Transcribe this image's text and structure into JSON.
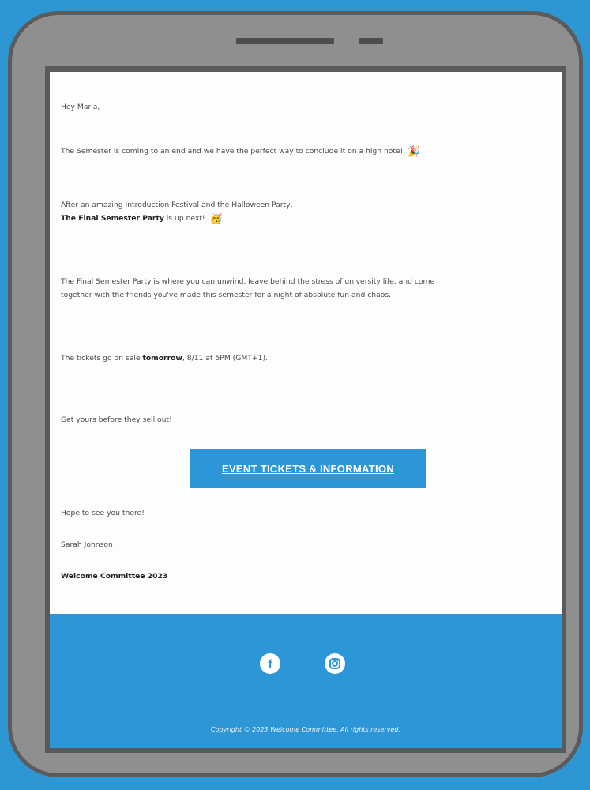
{
  "email": {
    "greeting": "Hey Maria,",
    "intro": "The Semester is coming to an end and we have the perfect way to conclude it on a high note!",
    "line2": "After an amazing Introduction Festival and the Halloween Party,",
    "highlight_bold": "The Final Semester Party",
    "highlight_rest": " is up next!",
    "desc_line1": "The Final Semester Party is where you can unwind, leave behind the stress of university life, and come",
    "desc_line2": "together with the friends you've made this semester for a night of absolute fun and chaos.",
    "tickets_prefix": "The tickets go on sale ",
    "tickets_bold": "tomorrow",
    "tickets_suffix": ", 8/11 at 5PM (GMT+1).",
    "get_yours": "Get yours before they sell out!",
    "cta_label": "EVENT TICKETS & INFORMATION",
    "sign_off": "Hope to see you there!",
    "sender": "Sarah Johnson",
    "team": "Welcome Committee 2023"
  },
  "footer": {
    "facebook_icon": "facebook-icon",
    "instagram_icon": "instagram-icon",
    "copyright": "Copyright © 2023 Welcome Committee, All rights reserved."
  },
  "colors": {
    "background": "#2e96d3",
    "tablet_frame": "#8f8f8f",
    "accent_blue": "#2d96d6"
  }
}
